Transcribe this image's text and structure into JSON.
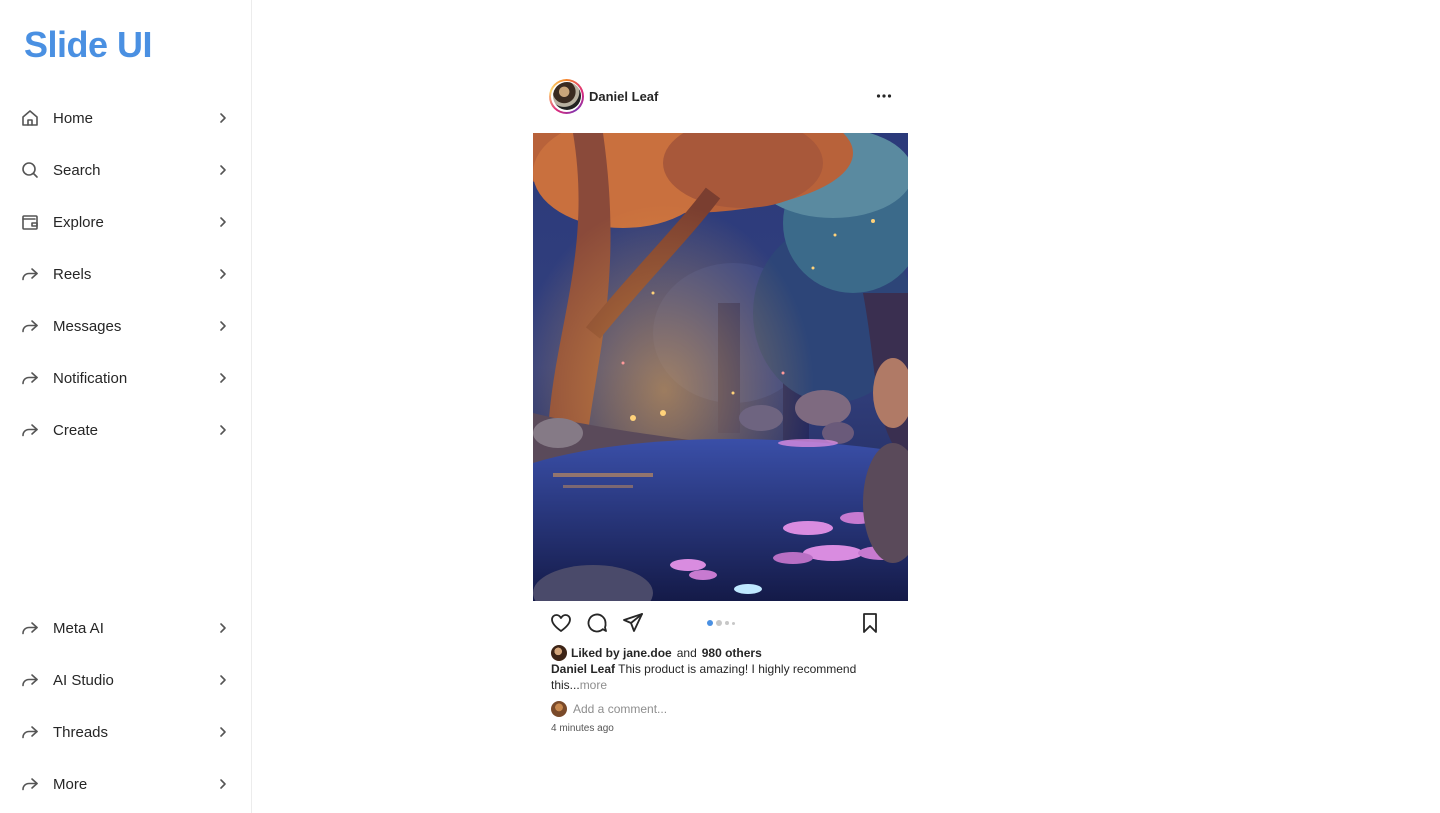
{
  "brand": "Slide UI",
  "sidebar": {
    "top_items": [
      {
        "label": "Home",
        "icon": "home-icon"
      },
      {
        "label": "Search",
        "icon": "search-icon"
      },
      {
        "label": "Explore",
        "icon": "wallet-icon"
      },
      {
        "label": "Reels",
        "icon": "share-arrow-icon"
      },
      {
        "label": "Messages",
        "icon": "share-arrow-icon"
      },
      {
        "label": "Notification",
        "icon": "share-arrow-icon"
      },
      {
        "label": "Create",
        "icon": "share-arrow-icon"
      }
    ],
    "bottom_items": [
      {
        "label": "Meta AI",
        "icon": "share-arrow-icon"
      },
      {
        "label": "AI Studio",
        "icon": "share-arrow-icon"
      },
      {
        "label": "Threads",
        "icon": "share-arrow-icon"
      },
      {
        "label": "More",
        "icon": "share-arrow-icon"
      }
    ]
  },
  "post": {
    "username": "Daniel Leaf",
    "liked_by_prefix": "Liked by",
    "liked_by_user": "jane.doe",
    "liked_and": "and",
    "liked_others": "980 others",
    "caption_user": "Daniel Leaf",
    "caption_text": "This product is amazing! I highly recommend this...",
    "caption_more": "more",
    "comment_placeholder": "Add a comment...",
    "timestamp": "4 minutes ago",
    "carousel_active_index": 0,
    "carousel_count": 4
  },
  "colors": {
    "brand": "#4a90e2",
    "dot_active": "#4a90e2",
    "dot_inactive": "#c7c7c7"
  }
}
